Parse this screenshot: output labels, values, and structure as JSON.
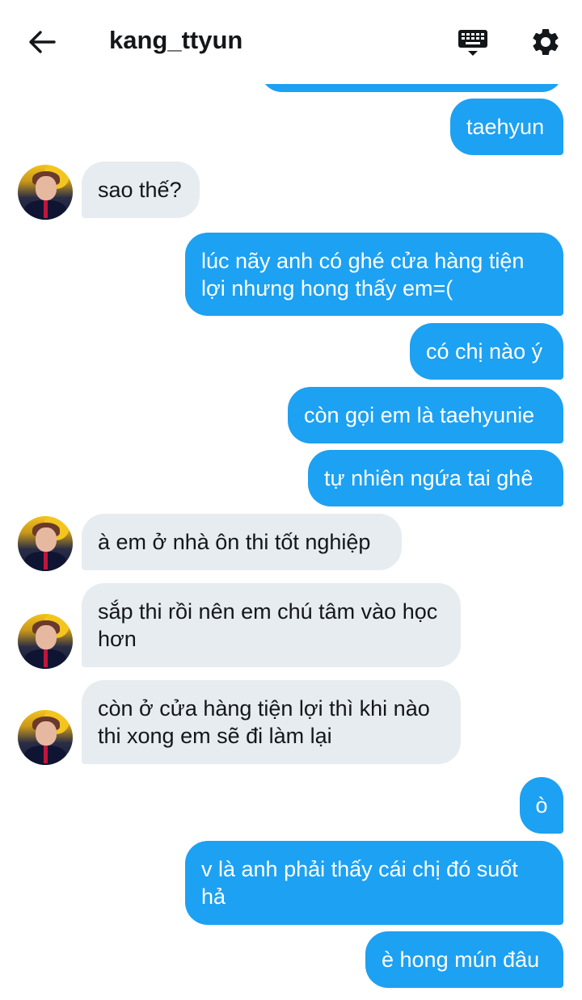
{
  "header": {
    "title": "kang_ttyun",
    "back_icon": "arrow-left-icon",
    "keyboard_icon": "keyboard-icon",
    "settings_icon": "gear-icon"
  },
  "colors": {
    "outgoing_bubble": "#1da1f2",
    "incoming_bubble": "#e6ecf0",
    "outgoing_text": "#ffffff",
    "incoming_text": "#14171a"
  },
  "messages": [
    {
      "from": "me",
      "text": "taehyun"
    },
    {
      "from": "them",
      "text": "sao thế?"
    },
    {
      "from": "me",
      "text": "lúc nãy anh có ghé cửa hàng tiện lợi nhưng hong thấy em=("
    },
    {
      "from": "me",
      "text": "có chị nào ý"
    },
    {
      "from": "me",
      "text": "còn gọi em là taehyunie"
    },
    {
      "from": "me",
      "text": "tự nhiên ngứa tai ghê"
    },
    {
      "from": "them",
      "text": "à em ở nhà ôn thi tốt nghiệp"
    },
    {
      "from": "them",
      "text": "sắp thi rồi nên em chú tâm vào học hơn"
    },
    {
      "from": "them",
      "text": "còn ở cửa hàng tiện lợi thì khi nào thi xong em sẽ đi làm lại"
    },
    {
      "from": "me",
      "text": "ò"
    },
    {
      "from": "me",
      "text": "v là anh phải thấy cái chị đó suốt hả"
    },
    {
      "from": "me",
      "text": "è hong mún đâu"
    }
  ]
}
